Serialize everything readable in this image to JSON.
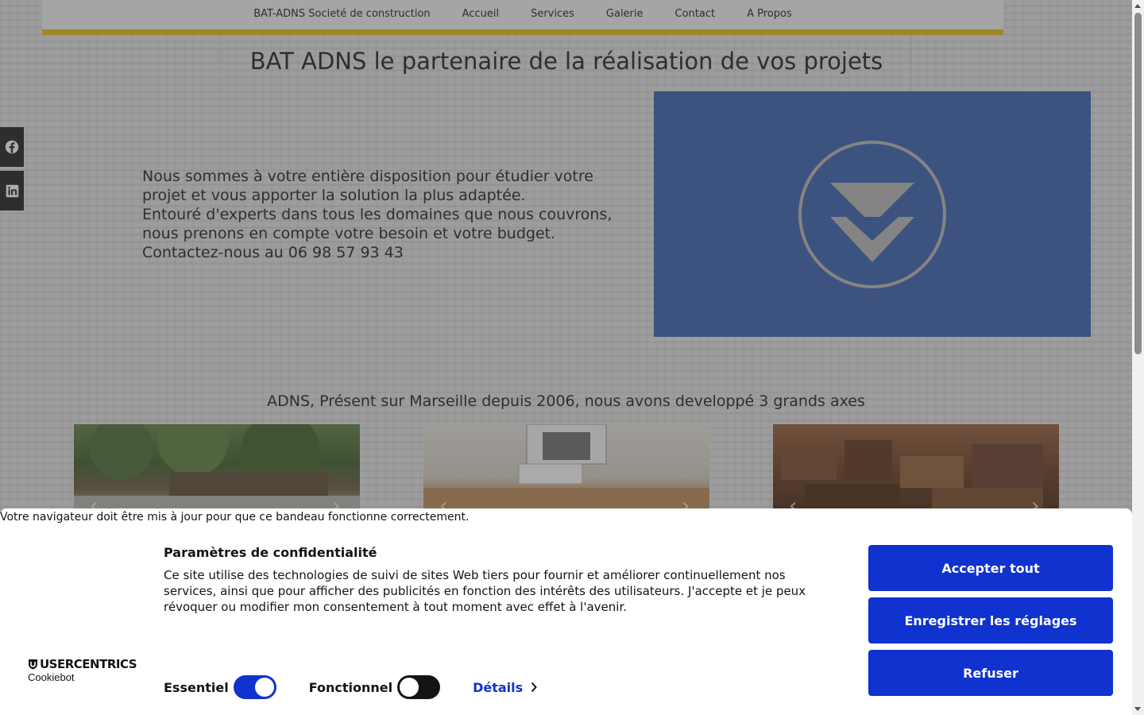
{
  "nav": {
    "items": [
      {
        "label": "BAT-ADNS Societé de construction"
      },
      {
        "label": "Accueil"
      },
      {
        "label": "Services"
      },
      {
        "label": "Galerie"
      },
      {
        "label": "Contact"
      },
      {
        "label": "A Propos"
      }
    ],
    "accent_color": "#e8c320"
  },
  "hero": {
    "title": "BAT ADNS le partenaire de la réalisation de vos projets",
    "intro_lines": [
      "Nous sommes à votre entière disposition pour étudier votre",
      "projet et vous apporter la solution la plus adaptée.",
      "Entouré d'experts dans tous les domaines que nous couvrons,",
      "nous prenons en compte votre besoin et votre budget.",
      "Contactez-nous au 06 98 57 93 43"
    ]
  },
  "social": {
    "icons": [
      "facebook-icon",
      "linkedin-icon"
    ]
  },
  "video": {
    "icon": "double-chevron-down-icon",
    "color": "#4a6fb5"
  },
  "axes": {
    "title": "ADNS, Présent sur Marseille depuis 2006, nous avons developpé 3 grands axes",
    "cards": [
      {
        "image": "garden-photo",
        "prev_icon": "‹",
        "next_icon": "›"
      },
      {
        "image": "room-photo",
        "prev_icon": "‹",
        "next_icon": "›"
      },
      {
        "image": "storage-photo",
        "prev_icon": "‹",
        "next_icon": "›"
      }
    ]
  },
  "cookie_banner": {
    "browser_warning": "Votre navigateur doit être mis à jour pour que ce bandeau fonctionne correctement.",
    "logo_main": "USERCENTRICS",
    "logo_sub": "Cookiebot",
    "title": "Paramètres de confidentialité",
    "text": "Ce site utilise des technologies de suivi de sites Web tiers pour fournir et améliorer continuellement nos services, ainsi que pour afficher des publicités en fonction des intérêts des utilisateurs. J'accepte et je peux révoquer ou modifier mon consentement à tout moment avec effet à l'avenir.",
    "toggles": [
      {
        "label": "Essentiel",
        "state": "on"
      },
      {
        "label": "Fonctionnel",
        "state": "off"
      }
    ],
    "details_label": "Détails",
    "buttons": {
      "accept": "Accepter tout",
      "save": "Enregistrer les réglages",
      "refuse": "Refuser"
    },
    "brand_color": "#1032cf"
  }
}
